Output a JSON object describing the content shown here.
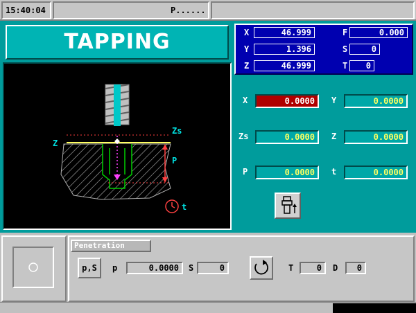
{
  "header": {
    "time": "15:40:04",
    "program": "P......"
  },
  "title": "TAPPING",
  "coords": {
    "x_label": "X",
    "x_value": "46.999",
    "y_label": "Y",
    "y_value": "1.396",
    "z_label": "Z",
    "z_value": "46.999",
    "f_label": "F",
    "f_value": "0.000",
    "s_label": "S",
    "s_value": "0",
    "t_label": "T",
    "t_value": "0"
  },
  "diagram": {
    "z_label": "Z",
    "zs_label": "Zs",
    "p_label": "P",
    "t_label": "t"
  },
  "fields": {
    "x_label": "X",
    "x_value": "0.0000",
    "y_label": "Y",
    "y_value": "0.0000",
    "zs_label": "Zs",
    "zs_value": "0.0000",
    "z_label": "Z",
    "z_value": "0.0000",
    "p_label": "P",
    "p_value": "0.0000",
    "t_label": "t",
    "t_value": "0.0000"
  },
  "penetration": {
    "title": "Penetration",
    "mode_label": "p,S",
    "p_label": "p",
    "p_value": "0.0000",
    "s_label": "S",
    "s_value": "0",
    "t_label": "T",
    "t_value": "0",
    "d_label": "D",
    "d_value": "0"
  },
  "colors": {
    "main": "#009c9c",
    "coords_bg": "#0000b0",
    "selected_field": "#b00000",
    "field_text": "#ffff60"
  }
}
